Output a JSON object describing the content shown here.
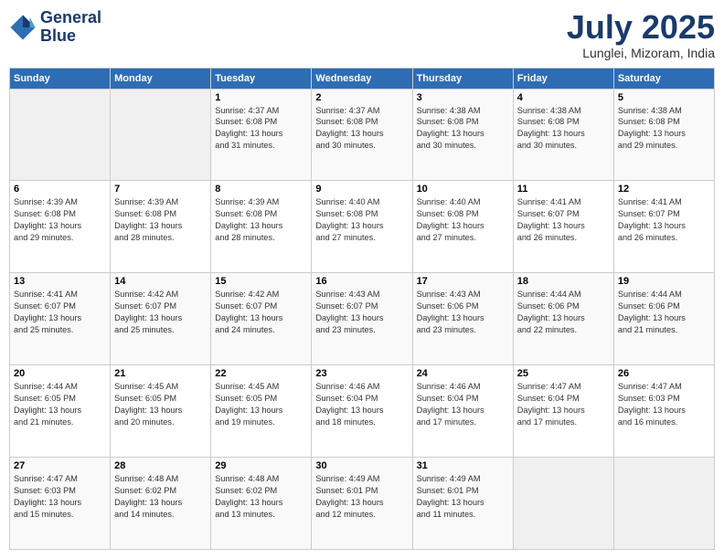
{
  "header": {
    "logo_line1": "General",
    "logo_line2": "Blue",
    "month_title": "July 2025",
    "location": "Lunglei, Mizoram, India"
  },
  "weekdays": [
    "Sunday",
    "Monday",
    "Tuesday",
    "Wednesday",
    "Thursday",
    "Friday",
    "Saturday"
  ],
  "weeks": [
    [
      {
        "day": "",
        "info": ""
      },
      {
        "day": "",
        "info": ""
      },
      {
        "day": "1",
        "info": "Sunrise: 4:37 AM\nSunset: 6:08 PM\nDaylight: 13 hours\nand 31 minutes."
      },
      {
        "day": "2",
        "info": "Sunrise: 4:37 AM\nSunset: 6:08 PM\nDaylight: 13 hours\nand 30 minutes."
      },
      {
        "day": "3",
        "info": "Sunrise: 4:38 AM\nSunset: 6:08 PM\nDaylight: 13 hours\nand 30 minutes."
      },
      {
        "day": "4",
        "info": "Sunrise: 4:38 AM\nSunset: 6:08 PM\nDaylight: 13 hours\nand 30 minutes."
      },
      {
        "day": "5",
        "info": "Sunrise: 4:38 AM\nSunset: 6:08 PM\nDaylight: 13 hours\nand 29 minutes."
      }
    ],
    [
      {
        "day": "6",
        "info": "Sunrise: 4:39 AM\nSunset: 6:08 PM\nDaylight: 13 hours\nand 29 minutes."
      },
      {
        "day": "7",
        "info": "Sunrise: 4:39 AM\nSunset: 6:08 PM\nDaylight: 13 hours\nand 28 minutes."
      },
      {
        "day": "8",
        "info": "Sunrise: 4:39 AM\nSunset: 6:08 PM\nDaylight: 13 hours\nand 28 minutes."
      },
      {
        "day": "9",
        "info": "Sunrise: 4:40 AM\nSunset: 6:08 PM\nDaylight: 13 hours\nand 27 minutes."
      },
      {
        "day": "10",
        "info": "Sunrise: 4:40 AM\nSunset: 6:08 PM\nDaylight: 13 hours\nand 27 minutes."
      },
      {
        "day": "11",
        "info": "Sunrise: 4:41 AM\nSunset: 6:07 PM\nDaylight: 13 hours\nand 26 minutes."
      },
      {
        "day": "12",
        "info": "Sunrise: 4:41 AM\nSunset: 6:07 PM\nDaylight: 13 hours\nand 26 minutes."
      }
    ],
    [
      {
        "day": "13",
        "info": "Sunrise: 4:41 AM\nSunset: 6:07 PM\nDaylight: 13 hours\nand 25 minutes."
      },
      {
        "day": "14",
        "info": "Sunrise: 4:42 AM\nSunset: 6:07 PM\nDaylight: 13 hours\nand 25 minutes."
      },
      {
        "day": "15",
        "info": "Sunrise: 4:42 AM\nSunset: 6:07 PM\nDaylight: 13 hours\nand 24 minutes."
      },
      {
        "day": "16",
        "info": "Sunrise: 4:43 AM\nSunset: 6:07 PM\nDaylight: 13 hours\nand 23 minutes."
      },
      {
        "day": "17",
        "info": "Sunrise: 4:43 AM\nSunset: 6:06 PM\nDaylight: 13 hours\nand 23 minutes."
      },
      {
        "day": "18",
        "info": "Sunrise: 4:44 AM\nSunset: 6:06 PM\nDaylight: 13 hours\nand 22 minutes."
      },
      {
        "day": "19",
        "info": "Sunrise: 4:44 AM\nSunset: 6:06 PM\nDaylight: 13 hours\nand 21 minutes."
      }
    ],
    [
      {
        "day": "20",
        "info": "Sunrise: 4:44 AM\nSunset: 6:05 PM\nDaylight: 13 hours\nand 21 minutes."
      },
      {
        "day": "21",
        "info": "Sunrise: 4:45 AM\nSunset: 6:05 PM\nDaylight: 13 hours\nand 20 minutes."
      },
      {
        "day": "22",
        "info": "Sunrise: 4:45 AM\nSunset: 6:05 PM\nDaylight: 13 hours\nand 19 minutes."
      },
      {
        "day": "23",
        "info": "Sunrise: 4:46 AM\nSunset: 6:04 PM\nDaylight: 13 hours\nand 18 minutes."
      },
      {
        "day": "24",
        "info": "Sunrise: 4:46 AM\nSunset: 6:04 PM\nDaylight: 13 hours\nand 17 minutes."
      },
      {
        "day": "25",
        "info": "Sunrise: 4:47 AM\nSunset: 6:04 PM\nDaylight: 13 hours\nand 17 minutes."
      },
      {
        "day": "26",
        "info": "Sunrise: 4:47 AM\nSunset: 6:03 PM\nDaylight: 13 hours\nand 16 minutes."
      }
    ],
    [
      {
        "day": "27",
        "info": "Sunrise: 4:47 AM\nSunset: 6:03 PM\nDaylight: 13 hours\nand 15 minutes."
      },
      {
        "day": "28",
        "info": "Sunrise: 4:48 AM\nSunset: 6:02 PM\nDaylight: 13 hours\nand 14 minutes."
      },
      {
        "day": "29",
        "info": "Sunrise: 4:48 AM\nSunset: 6:02 PM\nDaylight: 13 hours\nand 13 minutes."
      },
      {
        "day": "30",
        "info": "Sunrise: 4:49 AM\nSunset: 6:01 PM\nDaylight: 13 hours\nand 12 minutes."
      },
      {
        "day": "31",
        "info": "Sunrise: 4:49 AM\nSunset: 6:01 PM\nDaylight: 13 hours\nand 11 minutes."
      },
      {
        "day": "",
        "info": ""
      },
      {
        "day": "",
        "info": ""
      }
    ]
  ]
}
